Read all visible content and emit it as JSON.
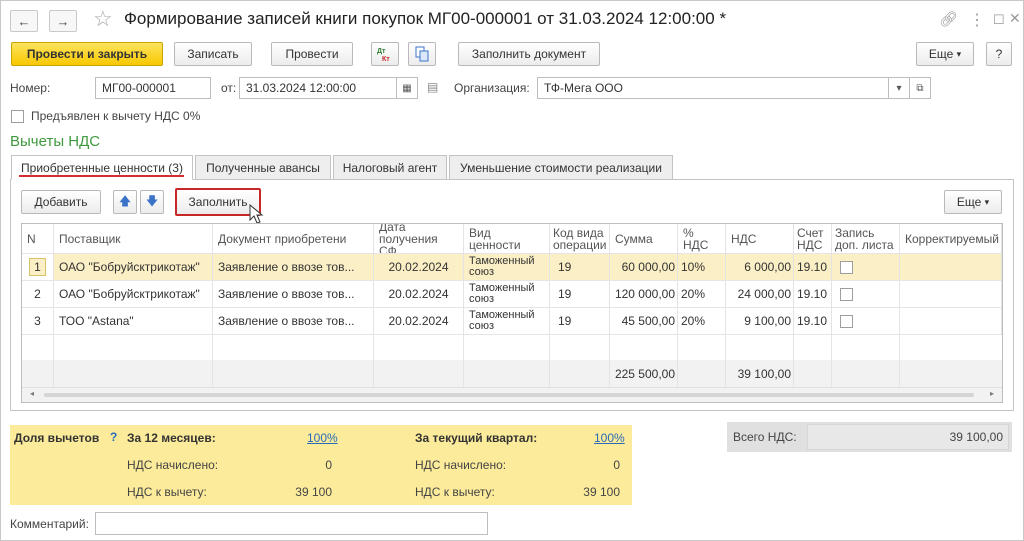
{
  "window": {
    "title": "Формирование записей книги покупок МГ00-000001 от 31.03.2024 12:00:00 *",
    "back": "←",
    "forward": "→"
  },
  "toolbar": {
    "post_close": "Провести и закрыть",
    "save": "Записать",
    "post": "Провести",
    "fill_document": "Заполнить документ",
    "more": "Еще",
    "help": "?"
  },
  "header": {
    "number_label": "Номер:",
    "number_value": "МГ00-000001",
    "date_label": "от:",
    "date_value": "31.03.2024 12:00:00",
    "org_label": "Организация:",
    "org_value": "ТФ-Мега ООО",
    "vat0_label": "Предъявлен к вычету НДС 0%"
  },
  "section_title": "Вычеты НДС",
  "tabs": [
    {
      "label": "Приобретенные ценности (3)"
    },
    {
      "label": "Полученные авансы"
    },
    {
      "label": "Налоговый агент"
    },
    {
      "label": "Уменьшение стоимости реализации"
    }
  ],
  "table_toolbar": {
    "add": "Добавить",
    "fill": "Заполнить",
    "more": "Еще"
  },
  "table": {
    "columns": [
      "N",
      "Поставщик",
      "Документ приобретени",
      "Дата получения СФ",
      "Вид ценности",
      "Код вида операции",
      "Сумма",
      "% НДС",
      "НДС",
      "Счет НДС",
      "Запись доп. листа",
      "Корректируемый"
    ],
    "rows": [
      {
        "n": "1",
        "supplier": "ОАО \"Бобруйсктрикотаж\"",
        "doc": "Заявление о ввозе тов...",
        "date": "20.02.2024",
        "kind": "Таможенный союз",
        "code": "19",
        "sum": "60 000,00",
        "rate": "10%",
        "vat": "6 000,00",
        "account": "19.10"
      },
      {
        "n": "2",
        "supplier": "ОАО \"Бобруйсктрикотаж\"",
        "doc": "Заявление о ввозе тов...",
        "date": "20.02.2024",
        "kind": "Таможенный союз",
        "code": "19",
        "sum": "120 000,00",
        "rate": "20%",
        "vat": "24 000,00",
        "account": "19.10"
      },
      {
        "n": "3",
        "supplier": "ТОО \"Astana\"",
        "doc": "Заявление о ввозе тов...",
        "date": "20.02.2024",
        "kind": "Таможенный союз",
        "code": "19",
        "sum": "45 500,00",
        "rate": "20%",
        "vat": "9 100,00",
        "account": "19.10"
      }
    ],
    "totals": {
      "sum": "225 500,00",
      "vat": "39 100,00"
    }
  },
  "shares": {
    "title": "Доля вычетов",
    "help": "?",
    "m12_label": "За 12 месяцев:",
    "m12_value": "100%",
    "q_label": "За текущий квартал:",
    "q_value": "100%",
    "accrued_label": "НДС начислено:",
    "deduct_label": "НДС к вычету:",
    "m12_accrued": "0",
    "m12_deduct": "39 100",
    "q_accrued": "0",
    "q_deduct": "39 100"
  },
  "total_vat": {
    "label": "Всего НДС:",
    "value": "39 100,00"
  },
  "comment": {
    "label": "Комментарий:",
    "value": ""
  }
}
